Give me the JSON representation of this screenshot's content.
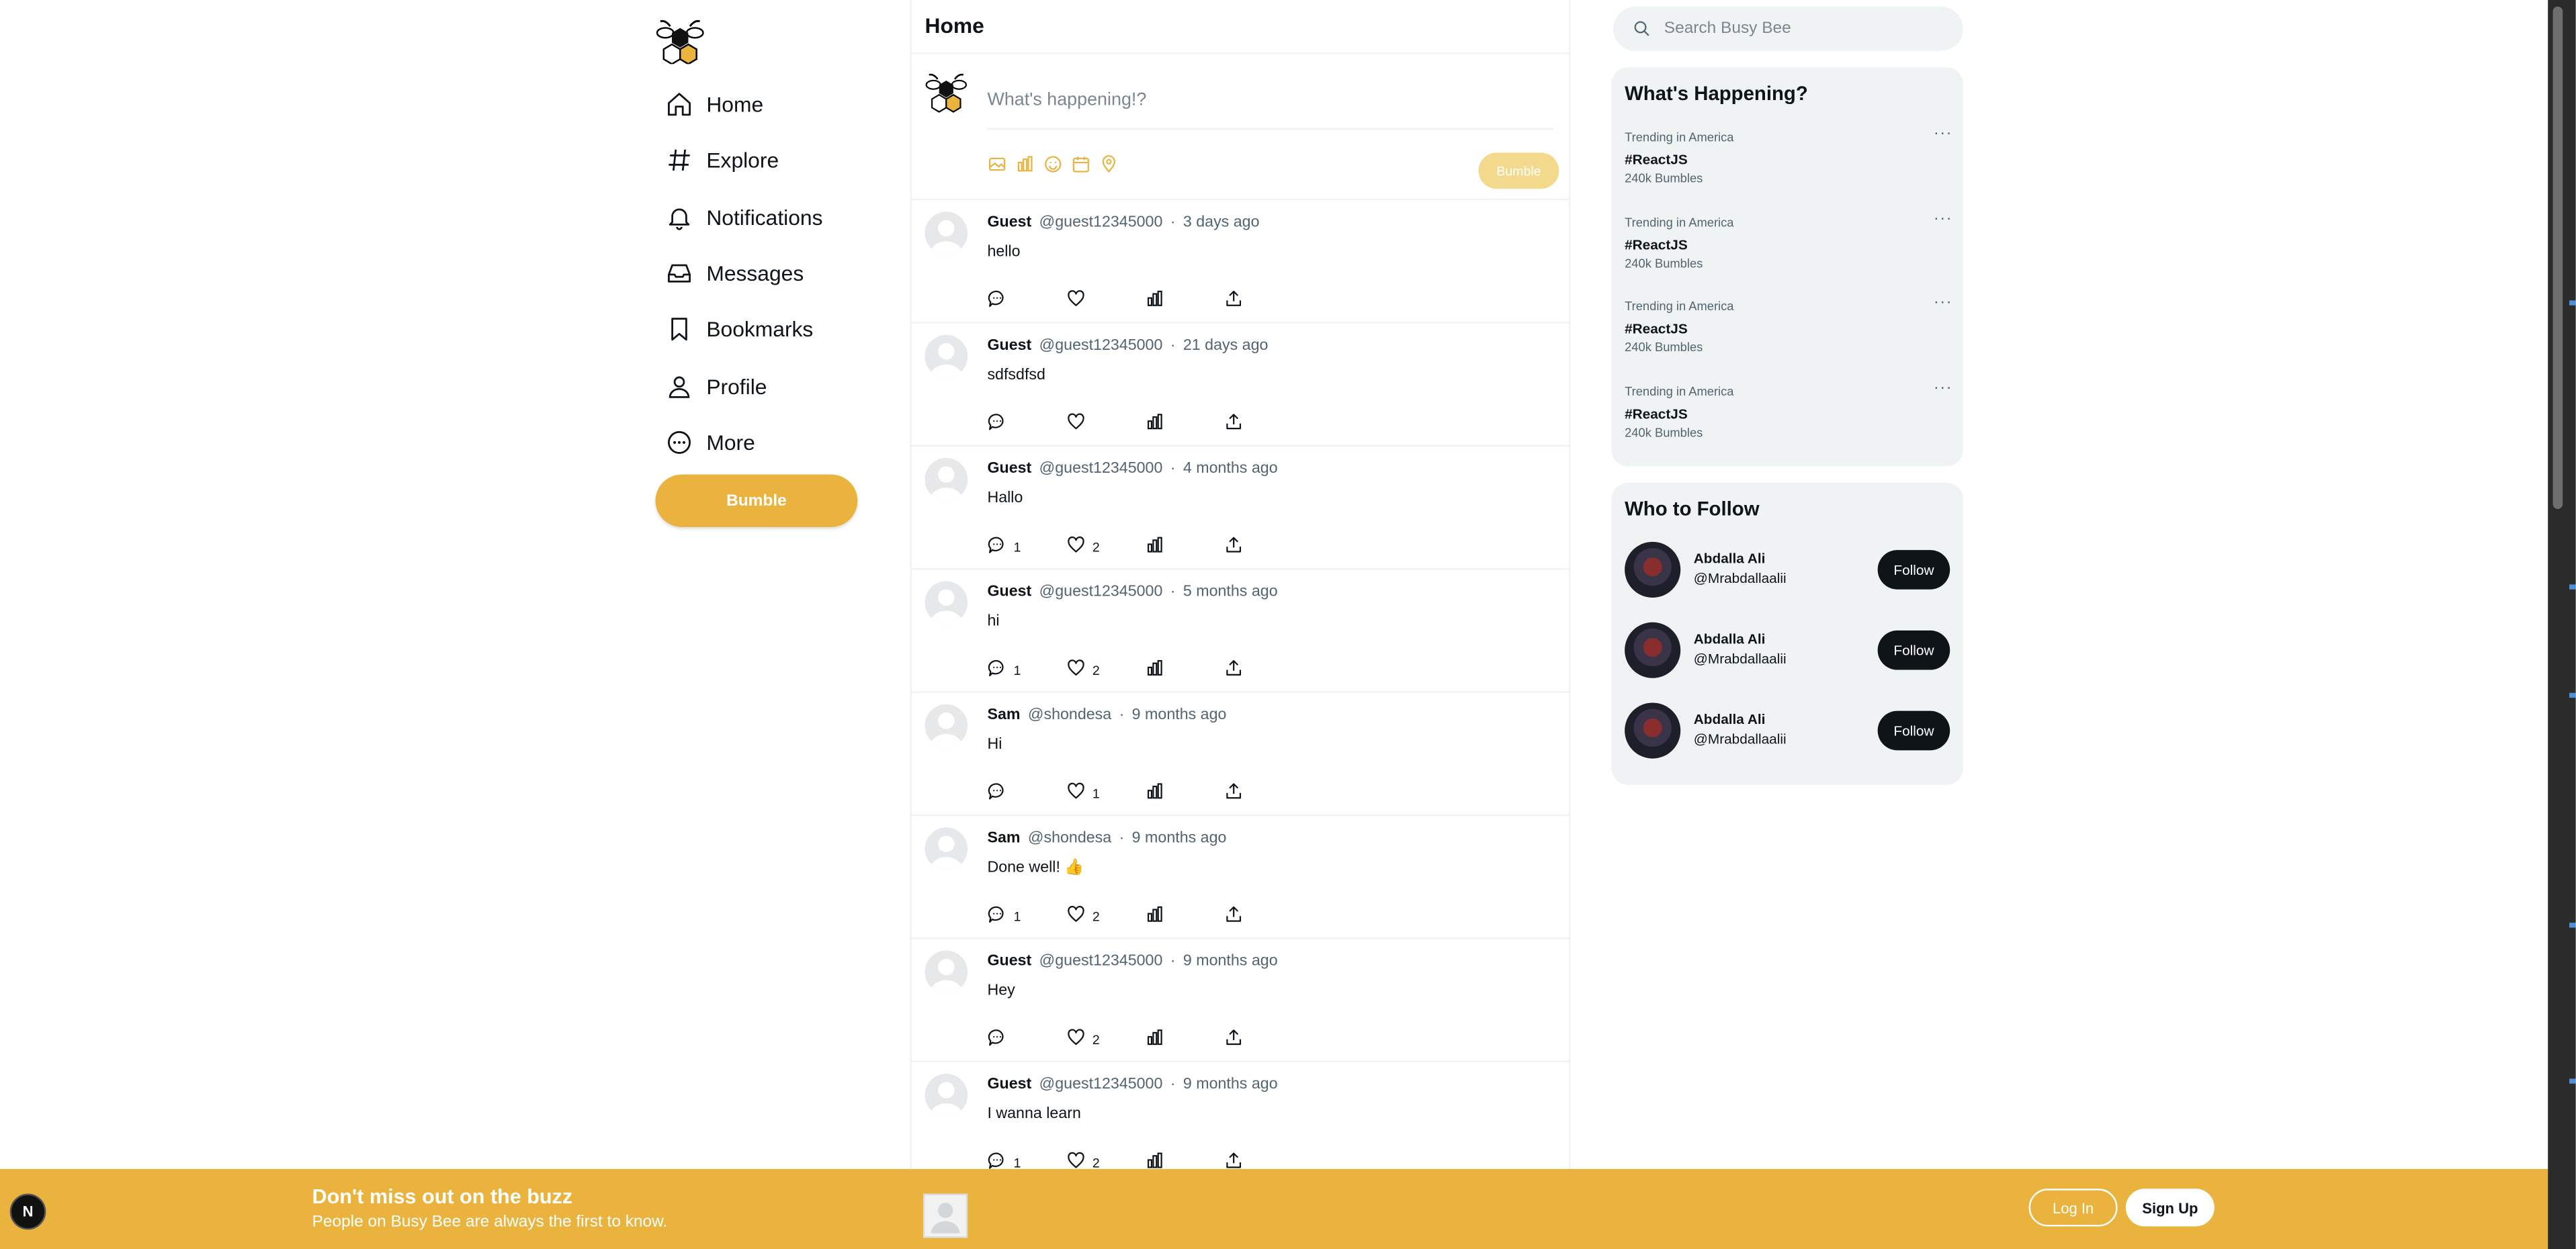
{
  "sidebar": {
    "logo": "busy-bee-logo",
    "items": [
      {
        "label": "Home",
        "icon": "home-icon"
      },
      {
        "label": "Explore",
        "icon": "hashtag-icon"
      },
      {
        "label": "Notifications",
        "icon": "bell-icon"
      },
      {
        "label": "Messages",
        "icon": "inbox-icon"
      },
      {
        "label": "Bookmarks",
        "icon": "bookmark-icon"
      },
      {
        "label": "Profile",
        "icon": "user-icon"
      },
      {
        "label": "More",
        "icon": "more-circle-icon"
      }
    ],
    "bumble_label": "Bumble"
  },
  "feed": {
    "title": "Home",
    "composer": {
      "placeholder": "What's happening!?",
      "tools": [
        "image-icon",
        "poll-icon",
        "emoji-icon",
        "calendar-icon",
        "location-icon"
      ],
      "submit_label": "Bumble"
    },
    "posts": [
      {
        "name": "Guest",
        "handle": "@guest12345000",
        "time": "3 days ago",
        "text": "hello",
        "replies": "",
        "likes": ""
      },
      {
        "name": "Guest",
        "handle": "@guest12345000",
        "time": "21 days ago",
        "text": "sdfsdfsd",
        "replies": "",
        "likes": ""
      },
      {
        "name": "Guest",
        "handle": "@guest12345000",
        "time": "4 months ago",
        "text": "Hallo",
        "replies": "1",
        "likes": "2"
      },
      {
        "name": "Guest",
        "handle": "@guest12345000",
        "time": "5 months ago",
        "text": "hi",
        "replies": "1",
        "likes": "2"
      },
      {
        "name": "Sam",
        "handle": "@shondesa",
        "time": "9 months ago",
        "text": "Hi",
        "replies": "",
        "likes": "1"
      },
      {
        "name": "Sam",
        "handle": "@shondesa",
        "time": "9 months ago",
        "text": "Done well! 👍",
        "replies": "1",
        "likes": "2"
      },
      {
        "name": "Guest",
        "handle": "@guest12345000",
        "time": "9 months ago",
        "text": "Hey",
        "replies": "",
        "likes": "2"
      },
      {
        "name": "Guest",
        "handle": "@guest12345000",
        "time": "9 months ago",
        "text": "I wanna learn",
        "replies": "1",
        "likes": "2"
      }
    ],
    "separator": "·"
  },
  "search": {
    "placeholder": "Search Busy Bee"
  },
  "trending": {
    "title": "What's Happening?",
    "items": [
      {
        "context": "Trending in America",
        "tag": "#ReactJS",
        "count": "240k Bumbles"
      },
      {
        "context": "Trending in America",
        "tag": "#ReactJS",
        "count": "240k Bumbles"
      },
      {
        "context": "Trending in America",
        "tag": "#ReactJS",
        "count": "240k Bumbles"
      },
      {
        "context": "Trending in America",
        "tag": "#ReactJS",
        "count": "240k Bumbles"
      }
    ],
    "more_glyph": "···"
  },
  "who_to_follow": {
    "title": "Who to Follow",
    "items": [
      {
        "name": "Abdalla Ali",
        "handle": "@Mrabdallaalii",
        "button": "Follow"
      },
      {
        "name": "Abdalla Ali",
        "handle": "@Mrabdallaalii",
        "button": "Follow"
      },
      {
        "name": "Abdalla Ali",
        "handle": "@Mrabdallaalii",
        "button": "Follow"
      }
    ]
  },
  "banner": {
    "title": "Don't miss out on the buzz",
    "subtitle": "People on Busy Bee are always the first to know.",
    "login_label": "Log In",
    "signup_label": "Sign Up",
    "badge": "N"
  },
  "colors": {
    "accent": "#eab33d",
    "accent_light": "#f3d98c",
    "text": "#0f1419",
    "muted": "#536471",
    "panel": "#eff3f4"
  }
}
